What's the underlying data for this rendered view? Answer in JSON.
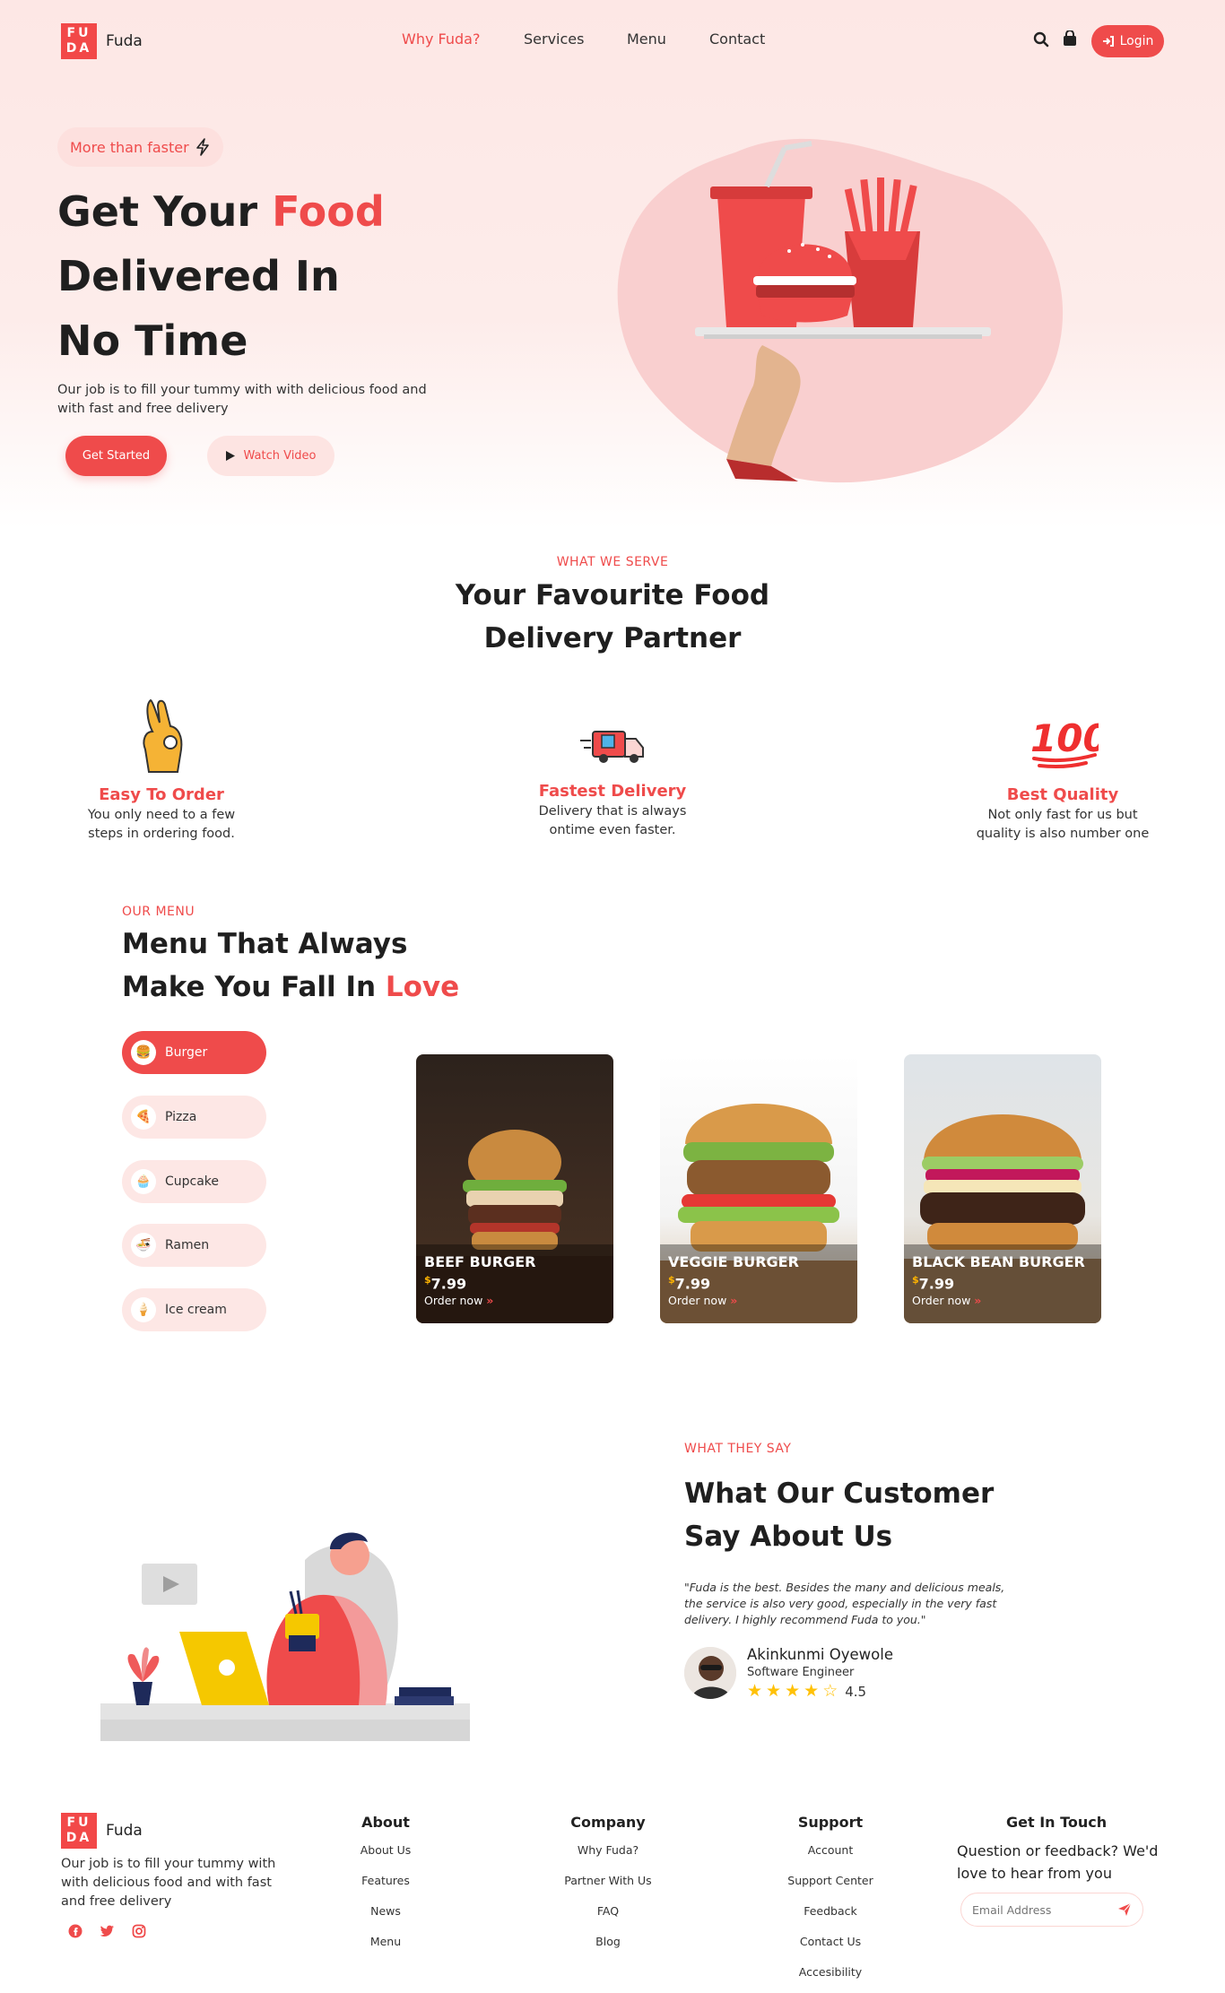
{
  "header": {
    "logo_top": "FU",
    "logo_bottom": "DA",
    "brand": "Fuda",
    "nav": [
      "Why Fuda?",
      "Services",
      "Menu",
      "Contact"
    ],
    "active_nav": "Why Fuda?",
    "login_label": "Login",
    "icons": [
      "search-icon",
      "shopping-bag-icon",
      "login-icon"
    ]
  },
  "hero": {
    "pill_text": "More than faster",
    "title_part1": "Get Your",
    "title_highlight": "Food",
    "title_line2": "Delivered In",
    "title_line3": "No Time",
    "description": "Our job is to fill your tummy with with delicious food and with fast and free delivery",
    "primary_button": "Get Started",
    "video_button": "Watch Video"
  },
  "serve": {
    "eyebrow": "WHAT WE SERVE",
    "title_line1": "Your Favourite Food",
    "title_line2": "Delivery Partner",
    "features": [
      {
        "title": "Easy To Order",
        "text": "You only need to a few steps in ordering food.",
        "icon": "ok-hand-icon"
      },
      {
        "title": "Fastest Delivery",
        "text": "Delivery that is always ontime even faster.",
        "icon": "delivery-truck-icon"
      },
      {
        "title": "Best Quality",
        "text": "Not only fast for us but quality is also number one",
        "icon": "hundred-points-icon"
      }
    ]
  },
  "menu": {
    "eyebrow": "OUR MENU",
    "title_line1": "Menu That Always",
    "title_line2_part": "Make You Fall In",
    "title_highlight": "Love",
    "categories": [
      {
        "label": "Burger",
        "active": true
      },
      {
        "label": "Pizza",
        "active": false
      },
      {
        "label": "Cupcake",
        "active": false
      },
      {
        "label": "Ramen",
        "active": false
      },
      {
        "label": "Ice cream",
        "active": false
      }
    ],
    "currency": "$",
    "order_label": "Order now",
    "items": [
      {
        "name": "BEEF BURGER",
        "price": "7.99"
      },
      {
        "name": "VEGGIE BURGER",
        "price": "7.99"
      },
      {
        "name": "BLACK BEAN BURGER",
        "price": "7.99"
      }
    ]
  },
  "testimonial": {
    "eyebrow": "WHAT THEY SAY",
    "title_line1": "What Our Customer",
    "title_line2": "Say About Us",
    "quote": "\"Fuda is the best. Besides the many and delicious meals, the service is also very good, especially in the very fast delivery. I highly recommend Fuda to you.\"",
    "name": "Akinkunmi Oyewole",
    "role": "Software Engineer",
    "rating": 4.5,
    "rating_text": "4.5"
  },
  "footer": {
    "logo_top": "FU",
    "logo_bottom": "DA",
    "brand": "Fuda",
    "description": "Our job is to fill your tummy with with delicious food and with fast and free delivery",
    "social": [
      "facebook-icon",
      "twitter-icon",
      "instagram-icon"
    ],
    "about": {
      "title": "About",
      "links": [
        "About Us",
        "Features",
        "News",
        "Menu"
      ]
    },
    "company": {
      "title": "Company",
      "links": [
        "Why Fuda?",
        "Partner With Us",
        "FAQ",
        "Blog"
      ]
    },
    "support": {
      "title": "Support",
      "links": [
        "Account",
        "Support Center",
        "Feedback",
        "Contact Us",
        "Accesibility"
      ]
    },
    "touch": {
      "title": "Get In Touch",
      "text": "Question or feedback? We'd love to hear from you",
      "email_placeholder": "Email Address"
    }
  },
  "colors": {
    "accent": "#ef4b4b",
    "hero_bg": "#fde7e5",
    "star": "#ffc107"
  }
}
